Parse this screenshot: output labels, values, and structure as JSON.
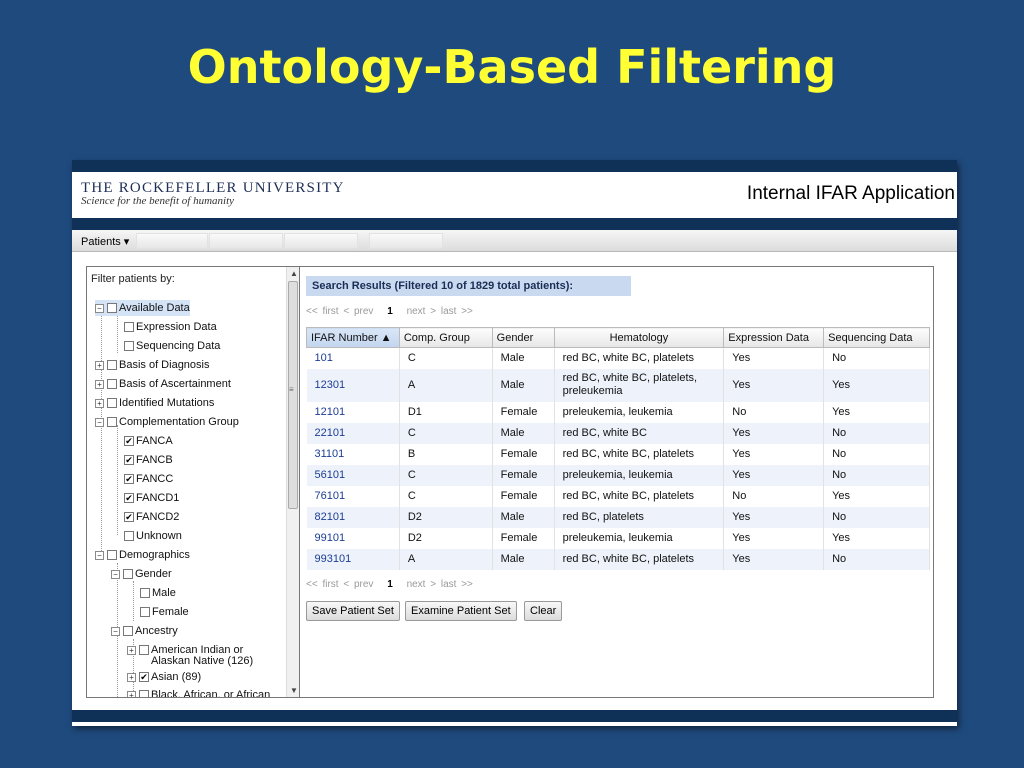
{
  "slide": {
    "title": "Ontology-Based Filtering"
  },
  "header": {
    "logo_main": "THE ROCKEFELLER UNIVERSITY",
    "logo_sub": "Science for the benefit of humanity",
    "app_name": "Internal IFAR Application"
  },
  "menu": {
    "patients": "Patients ▾"
  },
  "filter": {
    "header": "Filter patients by:",
    "nodes": [
      {
        "label": "Available Data",
        "toggle": "−",
        "checked": false
      },
      {
        "label": "Expression Data",
        "checked": false
      },
      {
        "label": "Sequencing Data",
        "checked": false
      },
      {
        "label": "Basis of Diagnosis",
        "toggle": "+",
        "checked": false
      },
      {
        "label": "Basis of Ascertainment",
        "toggle": "+",
        "checked": false
      },
      {
        "label": "Identified Mutations",
        "toggle": "+",
        "checked": false
      },
      {
        "label": "Complementation Group",
        "toggle": "−",
        "checked": false
      },
      {
        "label": "FANCA",
        "checked": true
      },
      {
        "label": "FANCB",
        "checked": true
      },
      {
        "label": "FANCC",
        "checked": true
      },
      {
        "label": "FANCD1",
        "checked": true
      },
      {
        "label": "FANCD2",
        "checked": true
      },
      {
        "label": "Unknown",
        "checked": false
      },
      {
        "label": "Demographics",
        "toggle": "−",
        "checked": false
      },
      {
        "label": "Gender",
        "toggle": "−",
        "checked": false
      },
      {
        "label": "Male",
        "checked": false
      },
      {
        "label": "Female",
        "checked": false
      },
      {
        "label": "Ancestry",
        "toggle": "−",
        "checked": false
      },
      {
        "label_line1": "American Indian or",
        "label_line2": "Alaskan Native (126)",
        "toggle": "+",
        "checked": false
      },
      {
        "label": "Asian (89)",
        "toggle": "+",
        "checked": true
      },
      {
        "label": "Black, African, or African",
        "toggle": "+",
        "checked": false
      }
    ]
  },
  "results": {
    "title": "Search Results (Filtered 10 of 1829 total patients):",
    "pager": {
      "first": "<< first",
      "prev": "< prev",
      "page": "1",
      "next": "next >",
      "last": "last >>"
    },
    "columns": [
      "IFAR Number ▲",
      "Comp. Group",
      "Gender",
      "Hematology",
      "Expression Data",
      "Sequencing Data"
    ],
    "rows": [
      {
        "id": "101",
        "group": "C",
        "gender": "Male",
        "hematology": "red BC, white BC, platelets",
        "expression": "Yes",
        "sequencing": "No"
      },
      {
        "id": "12301",
        "group": "A",
        "gender": "Male",
        "hematology": "red BC, white BC, platelets, preleukemia",
        "expression": "Yes",
        "sequencing": "Yes"
      },
      {
        "id": "12101",
        "group": "D1",
        "gender": "Female",
        "hematology": "preleukemia, leukemia",
        "expression": "No",
        "sequencing": "Yes"
      },
      {
        "id": "22101",
        "group": "C",
        "gender": "Male",
        "hematology": "red BC, white BC",
        "expression": "Yes",
        "sequencing": "No"
      },
      {
        "id": "31101",
        "group": "B",
        "gender": "Female",
        "hematology": "red BC, white BC, platelets",
        "expression": "Yes",
        "sequencing": "No"
      },
      {
        "id": "56101",
        "group": "C",
        "gender": "Female",
        "hematology": "preleukemia, leukemia",
        "expression": "Yes",
        "sequencing": "No"
      },
      {
        "id": "76101",
        "group": "C",
        "gender": "Female",
        "hematology": "red BC, white BC, platelets",
        "expression": "No",
        "sequencing": "Yes"
      },
      {
        "id": "82101",
        "group": "D2",
        "gender": "Male",
        "hematology": "red BC, platelets",
        "expression": "Yes",
        "sequencing": "No"
      },
      {
        "id": "99101",
        "group": "D2",
        "gender": "Female",
        "hematology": "preleukemia, leukemia",
        "expression": "Yes",
        "sequencing": "Yes"
      },
      {
        "id": "993101",
        "group": "A",
        "gender": "Male",
        "hematology": "red BC, white BC, platelets",
        "expression": "Yes",
        "sequencing": "No"
      }
    ],
    "buttons": {
      "save": "Save Patient Set",
      "examine": "Examine Patient Set",
      "clear": "Clear"
    }
  },
  "colors": {
    "slide_bg": "#1f4a7d",
    "title": "#ffff33",
    "band": "#0f3157",
    "row_alt": "#eef3fb",
    "link": "#1c3c95"
  }
}
